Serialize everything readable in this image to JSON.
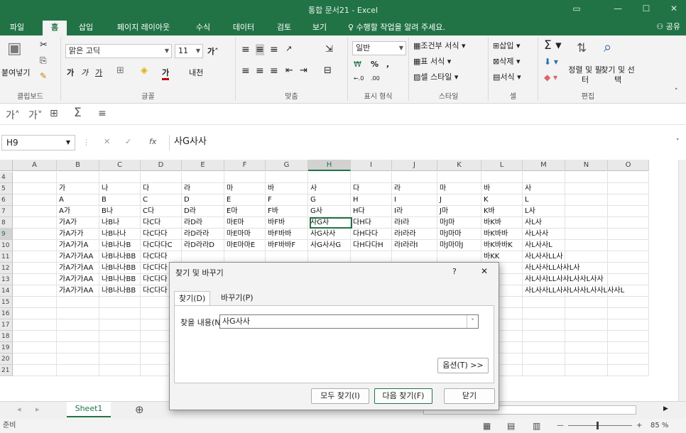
{
  "window": {
    "title": "통합 문서21 - Excel"
  },
  "tabs": [
    "파일",
    "홈",
    "삽입",
    "페이지 레이아웃",
    "수식",
    "데이터",
    "검토",
    "보기"
  ],
  "tell_me": "수행할 작업을 알려 주세요.",
  "share": "공유",
  "ribbon": {
    "paste": "붙여넣기",
    "clipboard": "클립보드",
    "font_name": "맑은 고딕",
    "font_size": "11",
    "font_group": "글꼴",
    "align_group": "맞춤",
    "number_format": "일반",
    "number_group": "표시 형식",
    "cond_format": "조건부 서식",
    "table_format": "표 서식",
    "cell_style": "셀 스타일",
    "style_group": "스타일",
    "insert": "삽입",
    "delete": "삭제",
    "format": "서식",
    "cell_group": "셀",
    "sort_filter": "정렬 및 필터",
    "find_select": "찾기 및 선택",
    "edit_group": "편집"
  },
  "formula": {
    "name_box": "H9",
    "fx": "fx",
    "value": "사G사사"
  },
  "columns": [
    "A",
    "B",
    "C",
    "D",
    "E",
    "F",
    "G",
    "H",
    "I",
    "J",
    "K",
    "L",
    "M",
    "N",
    "O"
  ],
  "rows": [
    {
      "n": "4",
      "cells": [
        "",
        "",
        "",
        "",
        "",
        "",
        "",
        "",
        "",
        "",
        "",
        "",
        "",
        "",
        ""
      ]
    },
    {
      "n": "5",
      "cells": [
        "",
        "가",
        "나",
        "다",
        "라",
        "마",
        "바",
        "사",
        "다",
        "라",
        "마",
        "바",
        "사",
        "",
        ""
      ]
    },
    {
      "n": "6",
      "cells": [
        "",
        "A",
        "B",
        "C",
        "D",
        "E",
        "F",
        "G",
        "H",
        "I",
        "J",
        "K",
        "L",
        "",
        ""
      ]
    },
    {
      "n": "7",
      "cells": [
        "",
        "A가",
        "B나",
        "C다",
        "D라",
        "E마",
        "F바",
        "G사",
        "H다",
        "I라",
        "J마",
        "K바",
        "L사",
        "",
        ""
      ]
    },
    {
      "n": "8",
      "cells": [
        "",
        "가A가",
        "나B나",
        "다C다",
        "라D라",
        "마E마",
        "바F바",
        "사G사",
        "다H다",
        "라I라",
        "마J마",
        "바K바",
        "사L사",
        "",
        ""
      ]
    },
    {
      "n": "9",
      "cells": [
        "",
        "가A가가",
        "나B나나",
        "다C다다",
        "라D라라",
        "마E마마",
        "바F바바",
        "사G사사",
        "다H다다",
        "라I라라",
        "마J마마",
        "바K바바",
        "사L사사",
        "",
        ""
      ]
    },
    {
      "n": "10",
      "cells": [
        "",
        "가A가가A",
        "나B나나B",
        "다C다다C",
        "라D라라D",
        "마E마마E",
        "바F바바F",
        "사G사사G",
        "다H다다H",
        "라I라라I",
        "마J마마J",
        "바K바바K",
        "사L사사L",
        "",
        ""
      ]
    },
    {
      "n": "11",
      "cells": [
        "",
        "가A가가AA",
        "나B나나BB",
        "다C다다",
        "",
        "",
        "",
        "",
        "",
        "",
        "",
        "바KK",
        "사L사사LL사",
        "",
        ""
      ]
    },
    {
      "n": "12",
      "cells": [
        "",
        "가A가가AA",
        "나B나나BB",
        "다C다다",
        "",
        "",
        "",
        "",
        "",
        "",
        "",
        "바KK",
        "사L사사LL사사L사",
        "",
        ""
      ]
    },
    {
      "n": "13",
      "cells": [
        "",
        "가A가가AA",
        "나B나나BB",
        "다C다다",
        "",
        "",
        "",
        "",
        "",
        "",
        "",
        "바KK",
        "사L사사LL사사L사사L사사",
        "",
        ""
      ]
    },
    {
      "n": "14",
      "cells": [
        "",
        "가A가가AA",
        "나B나나BB",
        "다C다다",
        "",
        "",
        "",
        "",
        "",
        "",
        "",
        "바KK",
        "사L사사LL사사L사사L사사L사사L",
        "",
        ""
      ]
    },
    {
      "n": "15",
      "cells": [
        "",
        "",
        "",
        "",
        "",
        "",
        "",
        "",
        "",
        "",
        "",
        "",
        "",
        "",
        ""
      ]
    },
    {
      "n": "16",
      "cells": [
        "",
        "",
        "",
        "",
        "",
        "",
        "",
        "",
        "",
        "",
        "",
        "",
        "",
        "",
        ""
      ]
    },
    {
      "n": "17",
      "cells": [
        "",
        "",
        "",
        "",
        "",
        "",
        "",
        "",
        "",
        "",
        "",
        "",
        "",
        "",
        ""
      ]
    },
    {
      "n": "18",
      "cells": [
        "",
        "",
        "",
        "",
        "",
        "",
        "",
        "",
        "",
        "",
        "",
        "",
        "",
        "",
        ""
      ]
    },
    {
      "n": "19",
      "cells": [
        "",
        "",
        "",
        "",
        "",
        "",
        "",
        "",
        "",
        "",
        "",
        "",
        "",
        "",
        ""
      ]
    },
    {
      "n": "20",
      "cells": [
        "",
        "",
        "",
        "",
        "",
        "",
        "",
        "",
        "",
        "",
        "",
        "",
        "",
        "",
        ""
      ]
    },
    {
      "n": "21",
      "cells": [
        "",
        "",
        "",
        "",
        "",
        "",
        "",
        "",
        "",
        "",
        "",
        "",
        "",
        "",
        ""
      ]
    }
  ],
  "sheet": {
    "tab": "Sheet1",
    "add": "⊕"
  },
  "status": {
    "ready": "준비",
    "zoom": "85 %"
  },
  "dialog": {
    "title": "찾기 및 바꾸기",
    "help": "?",
    "close": "✕",
    "tab_find": "찾기(D)",
    "tab_replace": "바꾸기(P)",
    "find_label": "찾을 내용(N):",
    "find_value": "사G사사",
    "options": "옵션(T) >>",
    "find_all": "모두 찾기(I)",
    "find_next": "다음 찾기(F)",
    "close_btn": "닫기"
  }
}
